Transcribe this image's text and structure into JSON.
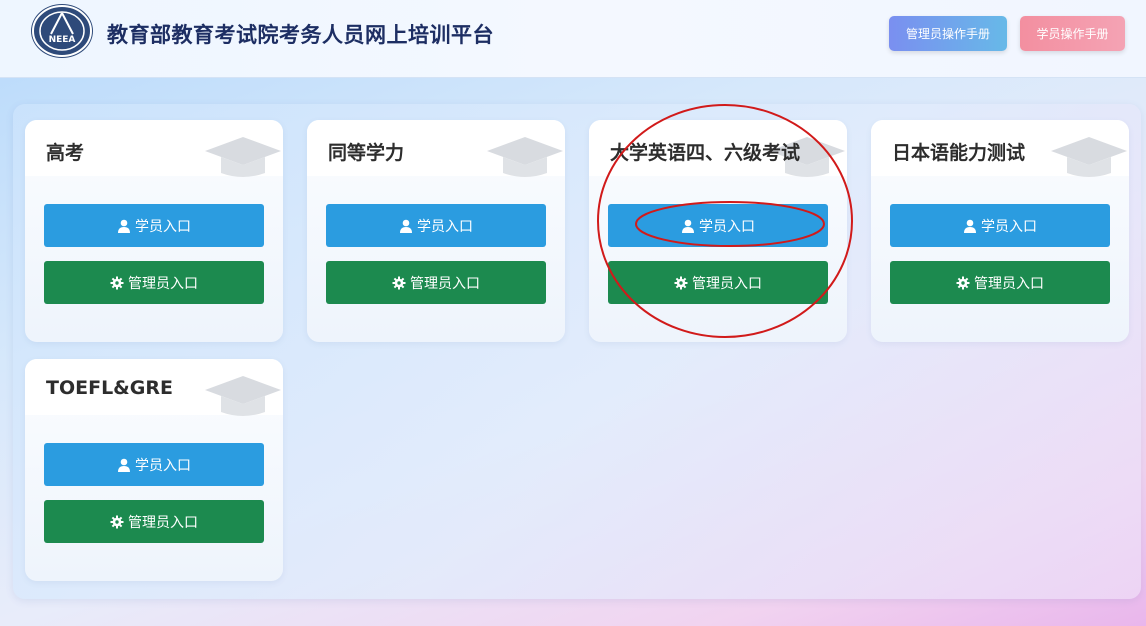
{
  "header": {
    "logo_text": "NEEA",
    "title": "教育部教育考试院考务人员网上培训平台",
    "admin_manual_label": "管理员操作手册",
    "student_manual_label": "学员操作手册"
  },
  "cards": [
    {
      "title": "高考",
      "student_label": "学员入口",
      "admin_label": "管理员入口"
    },
    {
      "title": "同等学力",
      "student_label": "学员入口",
      "admin_label": "管理员入口"
    },
    {
      "title": "大学英语四、六级考试",
      "student_label": "学员入口",
      "admin_label": "管理员入口"
    },
    {
      "title": "日本语能力测试",
      "student_label": "学员入口",
      "admin_label": "管理员入口"
    },
    {
      "title": "TOEFL&GRE",
      "student_label": "学员入口",
      "admin_label": "管理员入口"
    }
  ],
  "icons": {
    "student": "user-icon",
    "admin": "gear-icon",
    "card_decoration": "graduation-cap-icon"
  },
  "colors": {
    "title": "#1d2e63",
    "student_button": "#2b9ce0",
    "admin_button": "#1c8a4f",
    "annotation": "#d11a1a"
  }
}
